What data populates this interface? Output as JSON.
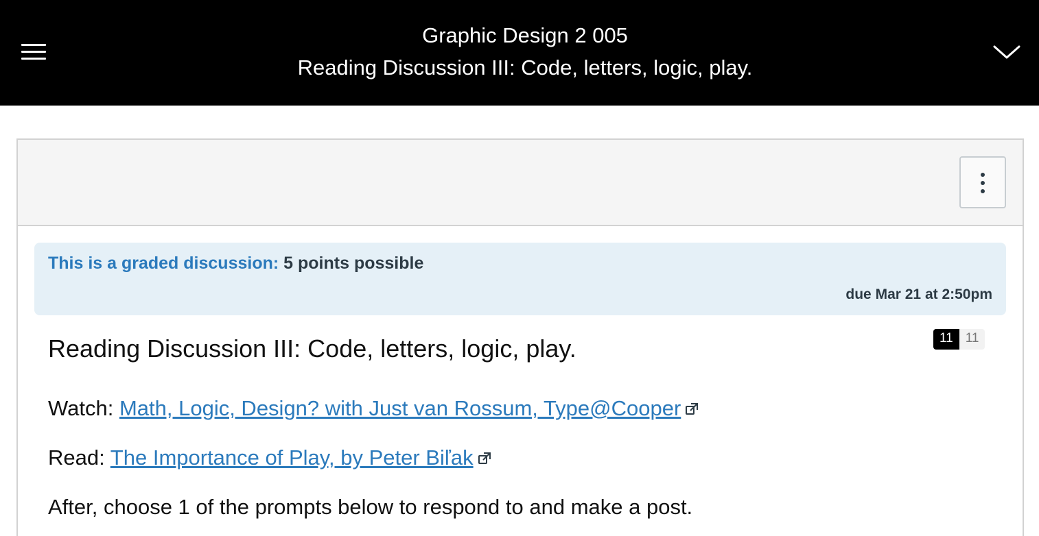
{
  "header": {
    "course_title": "Graphic Design 2 005",
    "page_subtitle": "Reading Discussion III: Code, letters, logic, play."
  },
  "icons": {
    "menu": "hamburger-menu-icon",
    "expand": "chevron-down-icon",
    "options": "kebab-menu-icon",
    "external": "external-link-icon"
  },
  "colors": {
    "header_bg": "#000000",
    "accent": "#2b7abc",
    "banner_bg": "#e5f0f7"
  },
  "grading": {
    "label": "This is a graded discussion:",
    "points": "5 points possible",
    "due": "due Mar 21 at 2:50pm"
  },
  "discussion": {
    "title": "Reading Discussion III: Code, letters, logic, play.",
    "unread_count": "11",
    "total_count": "11",
    "watch_prefix": "Watch:",
    "watch_link": "Math, Logic, Design? with Just van Rossum, Type@Cooper",
    "read_prefix": "Read:",
    "read_link": "The Importance of Play, by Peter Biľak",
    "instructions": "After, choose 1 of the prompts below to respond to and make a post."
  }
}
